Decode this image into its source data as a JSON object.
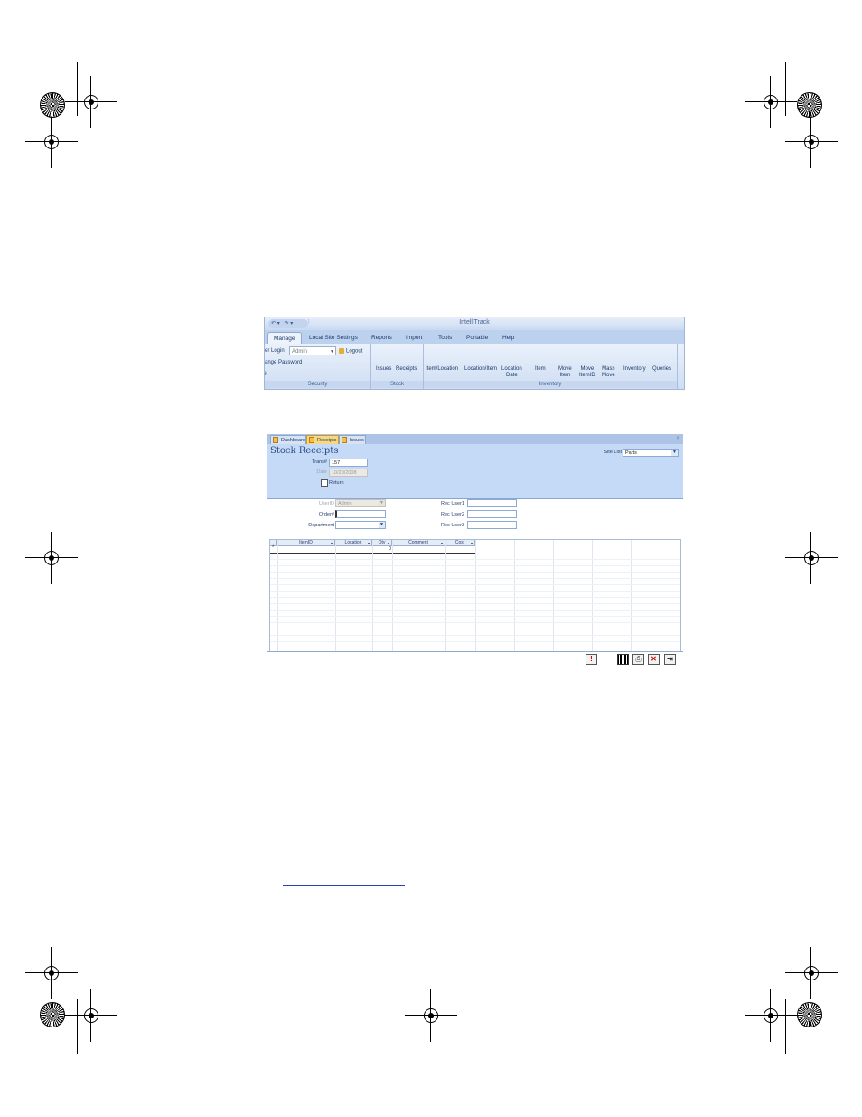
{
  "ribbon": {
    "app_title": "IntelliTrack",
    "qat_glyphs": [
      "↶ ▾",
      "↷ ▾",
      "⫶"
    ],
    "tabs": [
      "Manage",
      "Local Site Settings",
      "Reports",
      "Import",
      "Tools",
      "Portable",
      "Help"
    ],
    "active_tab": "Manage",
    "security": {
      "user_login_label": "er Login",
      "user_combo_value": "Admin",
      "logout_label": "Logout",
      "change_password_label": "ange Password",
      "exit_label": "it",
      "group_label": "Security"
    },
    "stock": {
      "issues_label": "Issues",
      "receipts_label": "Receipts",
      "group_label": "Stock"
    },
    "inventory": {
      "item_location_label": "Item/Location",
      "location_item_label": "Location/Item",
      "location_date_label1": "Location",
      "location_date_label2": "Date",
      "item_label": "Item",
      "move_item_label1": "Move",
      "move_item_label2": "Item",
      "move_itemid_label1": "Move",
      "move_itemid_label2": "ItemID",
      "mass_move_label1": "Mass",
      "mass_move_label2": "Move",
      "inventory_label": "Inventory",
      "queries_label": "Queries",
      "group_label": "Inventory"
    }
  },
  "form": {
    "doc_tabs": [
      "Dashboard",
      "Receipts",
      "Issues"
    ],
    "active_doc_tab": "Receipts",
    "title": "Stock Receipts",
    "site_list_label": "Site List",
    "site_list_value": "Parts",
    "trans_label": "Trans#",
    "trans_value": "157",
    "date_label": "Date",
    "date_value": "10/20/2008",
    "return_label": "Return",
    "userid_label": "UserID",
    "userid_value": "Admin",
    "order_label": "Order#",
    "order_value": "",
    "department_label": "Department",
    "department_value": "",
    "rec_user1_label": "Rec User1",
    "rec_user2_label": "Rec User2",
    "rec_user3_label": "Rec User3",
    "grid_columns": [
      "ItemID",
      "Location",
      "Qty",
      "Comment",
      "Cost"
    ],
    "new_row_marker": "*",
    "new_row_qty": "0",
    "toolbar_glyphs": {
      "alert": "!",
      "printer": "⎙",
      "delete": "✕",
      "exit": "⇥"
    }
  }
}
